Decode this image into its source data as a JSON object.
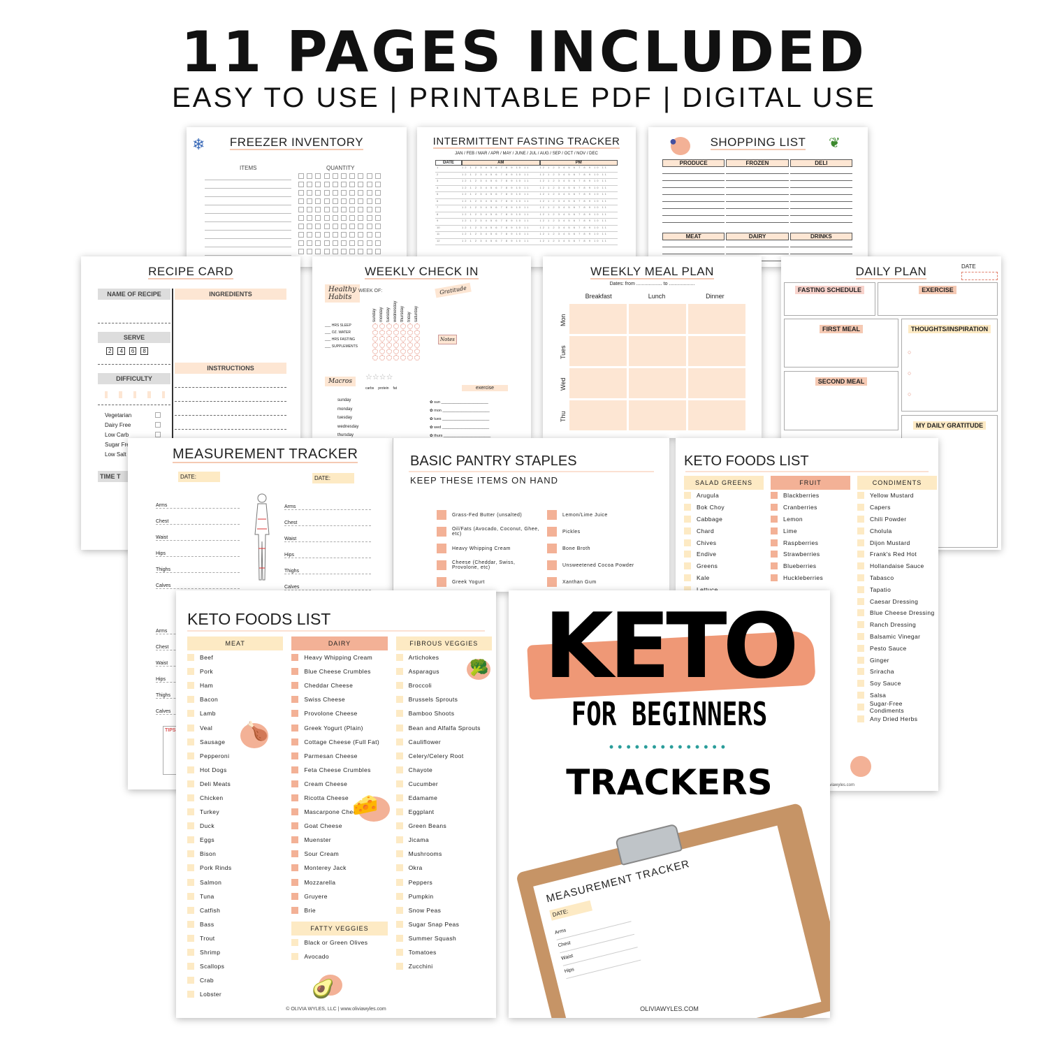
{
  "header": {
    "title": "11 PAGES INCLUDED",
    "subtitle": "EASY TO USE | PRINTABLE PDF | DIGITAL USE"
  },
  "colors": {
    "peach": "#fde6d3",
    "salmon": "#f3b196",
    "cream": "#fdeac4",
    "teal": "#2a9d9a"
  },
  "freezer": {
    "title": "FREEZER INVENTORY",
    "col_items": "ITEMS",
    "col_quantity": "QUANTITY",
    "icon": "snowflake-icon"
  },
  "fasting": {
    "title": "INTERMITTENT FASTING TRACKER",
    "months": "JAN / FEB / MAR / APR / MAY / JUNE / JUL / AUG / SEP / OCT / NOV / DEC",
    "col_date": "DATE",
    "col_am": "AM",
    "col_pm": "PM"
  },
  "shopping": {
    "title": "SHOPPING LIST",
    "sections": [
      "PRODUCE",
      "FROZEN",
      "DELI",
      "MEAT",
      "DAIRY",
      "DRINKS"
    ]
  },
  "recipe": {
    "title": "RECIPE CARD",
    "name": "NAME OF RECIPE",
    "ingredients": "INGREDIENTS",
    "serve": "SERVE",
    "serve_options": [
      "2",
      "4",
      "6",
      "8"
    ],
    "difficulty": "DIFFICULTY",
    "instructions": "INSTRUCTIONS",
    "diets": [
      "Vegetarian",
      "Dairy Free",
      "Low Carb",
      "Sugar Free",
      "Low Salt"
    ],
    "time": "TIME T"
  },
  "checkin": {
    "title": "WEEKLY CHECK IN",
    "healthy": "Healthy Habits",
    "week_of": "WEEK OF:",
    "gratitude": "Gratitude",
    "notes": "Notes",
    "habits": [
      "HRS SLEEP",
      "OZ. WATER",
      "HRS FASTING",
      "SUPPLEMENTS"
    ],
    "days": [
      "sunday",
      "monday",
      "tuesday",
      "wednesday",
      "thursday",
      "friday",
      "saturday"
    ],
    "macros": "Macros",
    "macro_cols": [
      "carbs",
      "protein",
      "fat"
    ],
    "macro_days": [
      "sunday",
      "monday",
      "tuesday",
      "wednesday",
      "thursday"
    ],
    "exercise": "exercise",
    "ex_days": [
      "sun",
      "mon",
      "tues",
      "wed",
      "thurs"
    ]
  },
  "mealplan": {
    "title": "WEEKLY MEAL PLAN",
    "dates": "Dates: from ................... to ...................",
    "cols": [
      "Breakfast",
      "Lunch",
      "Dinner"
    ],
    "rows": [
      "Mon",
      "Tues",
      "Wed",
      "Thu"
    ]
  },
  "daily": {
    "title": "DAILY PLAN",
    "date": "DATE",
    "fasting": "FASTING SCHEDULE",
    "exercise": "EXERCISE",
    "first": "FIRST MEAL",
    "thoughts": "THOUGHTS/INSPIRATION",
    "second": "SECOND MEAL",
    "gratitude": "MY DAILY GRATITUDE"
  },
  "measure": {
    "title": "MEASUREMENT TRACKER",
    "date": "DATE:",
    "parts": [
      "Arms",
      "Chest",
      "Waist",
      "Hips",
      "Thighs",
      "Calves"
    ],
    "tips": "TIPS"
  },
  "pantry": {
    "title": "BASIC PANTRY STAPLES",
    "subtitle": "KEEP THESE ITEMS ON HAND",
    "left": [
      "Grass-Fed Butter (unsalted)",
      "Oil/Fats (Avocado, Coconut, Ghee, etc)",
      "Heavy Whipping Cream",
      "Cheese (Cheddar, Swiss, Provolone, etc)",
      "Greek Yogurt"
    ],
    "right": [
      "Lemon/Lime Juice",
      "Pickles",
      "Bone Broth",
      "Unsweetened Cocoa Powder",
      "Xanthan Gum"
    ]
  },
  "keto2": {
    "title": "KETO FOODS LIST",
    "footer": "www.oliviawyles.com",
    "columns": [
      {
        "header": "SALAD GREENS",
        "style": "cream",
        "items": [
          "Arugula",
          "Bok Choy",
          "Cabbage",
          "Chard",
          "Chives",
          "Endive",
          "Greens",
          "Kale",
          "Lettuce"
        ]
      },
      {
        "header": "FRUIT",
        "style": "salmon",
        "items": [
          "Blackberries",
          "Cranberries",
          "Lemon",
          "Lime",
          "Raspberries",
          "Strawberries",
          "Blueberries",
          "Huckleberries"
        ]
      },
      {
        "header": "CONDIMENTS",
        "style": "cream",
        "items": [
          "Yellow Mustard",
          "Capers",
          "Chili Powder",
          "Cholula",
          "Dijon Mustard",
          "Frank's Red Hot",
          "Hollandaise Sauce",
          "Tabasco",
          "Tapatio",
          "Caesar Dressing",
          "Blue Cheese Dressing",
          "Ranch Dressing",
          "Balsamic Vinegar",
          "Pesto Sauce",
          "Ginger",
          "Sriracha",
          "Soy Sauce",
          "Salsa",
          "Sugar-Free Condiments",
          "Any Dried Herbs"
        ]
      }
    ]
  },
  "keto1": {
    "title": "KETO FOODS LIST",
    "footer": "© OLIVIA WYLES, LLC | www.oliviawyles.com",
    "columns": [
      {
        "header": "MEAT",
        "style": "cream",
        "items": [
          "Beef",
          "Pork",
          "Ham",
          "Bacon",
          "Lamb",
          "Veal",
          "Sausage",
          "Pepperoni",
          "Hot Dogs",
          "Deli Meats",
          "Chicken",
          "Turkey",
          "Duck",
          "Eggs",
          "Bison",
          "Pork Rinds",
          "Salmon",
          "Tuna",
          "Catfish",
          "Bass",
          "Trout",
          "Shrimp",
          "Scallops",
          "Crab",
          "Lobster"
        ]
      },
      {
        "header": "DAIRY",
        "style": "salmon",
        "items": [
          "Heavy Whipping Cream",
          "Blue Cheese Crumbles",
          "Cheddar Cheese",
          "Swiss Cheese",
          "Provolone Cheese",
          "Greek Yogurt (Plain)",
          "Cottage Cheese (Full Fat)",
          "Parmesan Cheese",
          "Feta Cheese Crumbles",
          "Cream Cheese",
          "Ricotta Cheese",
          "Mascarpone Cheese",
          "Goat Cheese",
          "Muenster",
          "Sour Cream",
          "Monterey Jack",
          "Mozzarella",
          "Gruyere",
          "Brie"
        ]
      },
      {
        "header": "FIBROUS VEGGIES",
        "style": "cream",
        "items": [
          "Artichokes",
          "Asparagus",
          "Broccoli",
          "Brussels Sprouts",
          "Bamboo Shoots",
          "Bean and Alfalfa Sprouts",
          "Cauliflower",
          "Celery/Celery Root",
          "Chayote",
          "Cucumber",
          "Edamame",
          "Eggplant",
          "Green Beans",
          "Jicama",
          "Mushrooms",
          "Okra",
          "Peppers",
          "Pumpkin",
          "Snow Peas",
          "Sugar Snap Peas",
          "Summer Squash",
          "Tomatoes",
          "Zucchini"
        ]
      }
    ],
    "fatty": {
      "header": "FATTY VEGGIES",
      "items": [
        "Black or Green Olives",
        "Avocado"
      ]
    }
  },
  "cover": {
    "keto": "KETO",
    "for_beginners": "FOR BEGINNERS",
    "trackers": "TRACKERS",
    "clip_title": "MEASUREMENT TRACKER",
    "clip_date": "DATE:",
    "clip_parts": [
      "Arms",
      "Chest",
      "Waist",
      "Hips"
    ],
    "site": "OLIVIAWYLES.COM"
  }
}
